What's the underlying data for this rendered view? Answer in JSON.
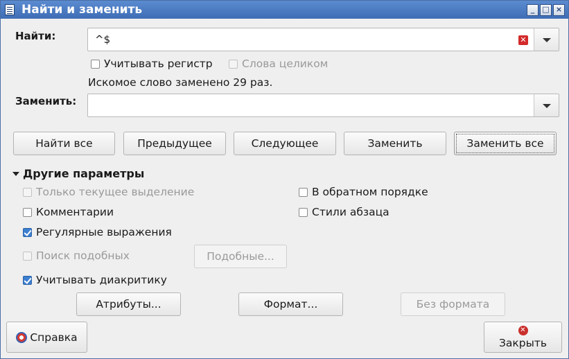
{
  "window": {
    "title": "Найти и заменить",
    "minimize_symbol": "_",
    "maximize_symbol": "□",
    "close_symbol": "×"
  },
  "find": {
    "label": "Найти:",
    "value": "^$",
    "match_case_label": "Учитывать регистр",
    "match_case_checked": false,
    "whole_words_label": "Слова целиком",
    "whole_words_enabled": false,
    "status": "Искомое слово заменено 29 раз."
  },
  "replace": {
    "label": "Заменить:",
    "value": ""
  },
  "actions": {
    "find_all": "Найти все",
    "previous": "Предыдущее",
    "next": "Следующее",
    "replace": "Заменить",
    "replace_all": "Заменить все"
  },
  "other_options": {
    "title": "Другие параметры",
    "current_selection": "Только текущее выделение",
    "backwards": "В обратном порядке",
    "comments": "Комментарии",
    "paragraph_styles": "Стили абзаца",
    "regex": "Регулярные выражения",
    "similarity": "Поиск подобных",
    "similarity_button": "Подобные...",
    "diacritics": "Учитывать диакритику",
    "attributes_button": "Атрибуты...",
    "format_button": "Формат...",
    "no_format_button": "Без формата"
  },
  "footer": {
    "help": "Справка",
    "close": "Закрыть"
  },
  "icons": {
    "app": "writer-document-icon",
    "clear": "clear-icon",
    "help": "help-icon",
    "close": "close-icon"
  },
  "colors": {
    "titlebar": "#4a7cc4",
    "accent": "#3c7fd0",
    "clear_icon": "#d42a2a"
  }
}
